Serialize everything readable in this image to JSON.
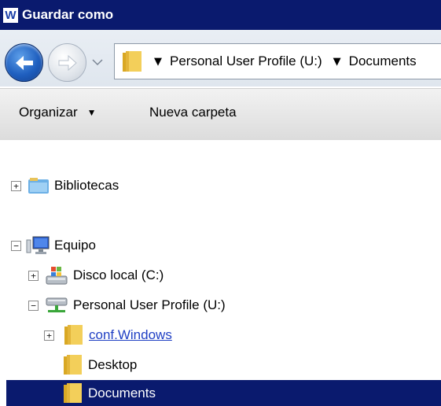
{
  "window": {
    "app_icon_letter": "W",
    "title": "Guardar como"
  },
  "nav": {
    "path_segments": [
      "Personal User Profile (U:)",
      "Documents"
    ]
  },
  "toolbar": {
    "organize_label": "Organizar",
    "new_folder_label": "Nueva carpeta"
  },
  "tree": {
    "libraries": "Bibliotecas",
    "computer": "Equipo",
    "local_disk": "Disco local (C:)",
    "profile_drive": "Personal User Profile (U:)",
    "conf_windows": "conf.Windows",
    "desktop": "Desktop",
    "documents": "Documents"
  },
  "expanders": {
    "collapsed": "+",
    "expanded": "−"
  },
  "colors": {
    "title_bar": "#0a1a6e",
    "selection": "#0a1a6e",
    "link": "#1f3fc4"
  },
  "icons": [
    "word-app-icon",
    "back-arrow-icon",
    "forward-arrow-icon",
    "folder-icon",
    "libraries-icon",
    "computer-icon",
    "local-disk-icon",
    "network-drive-icon"
  ]
}
